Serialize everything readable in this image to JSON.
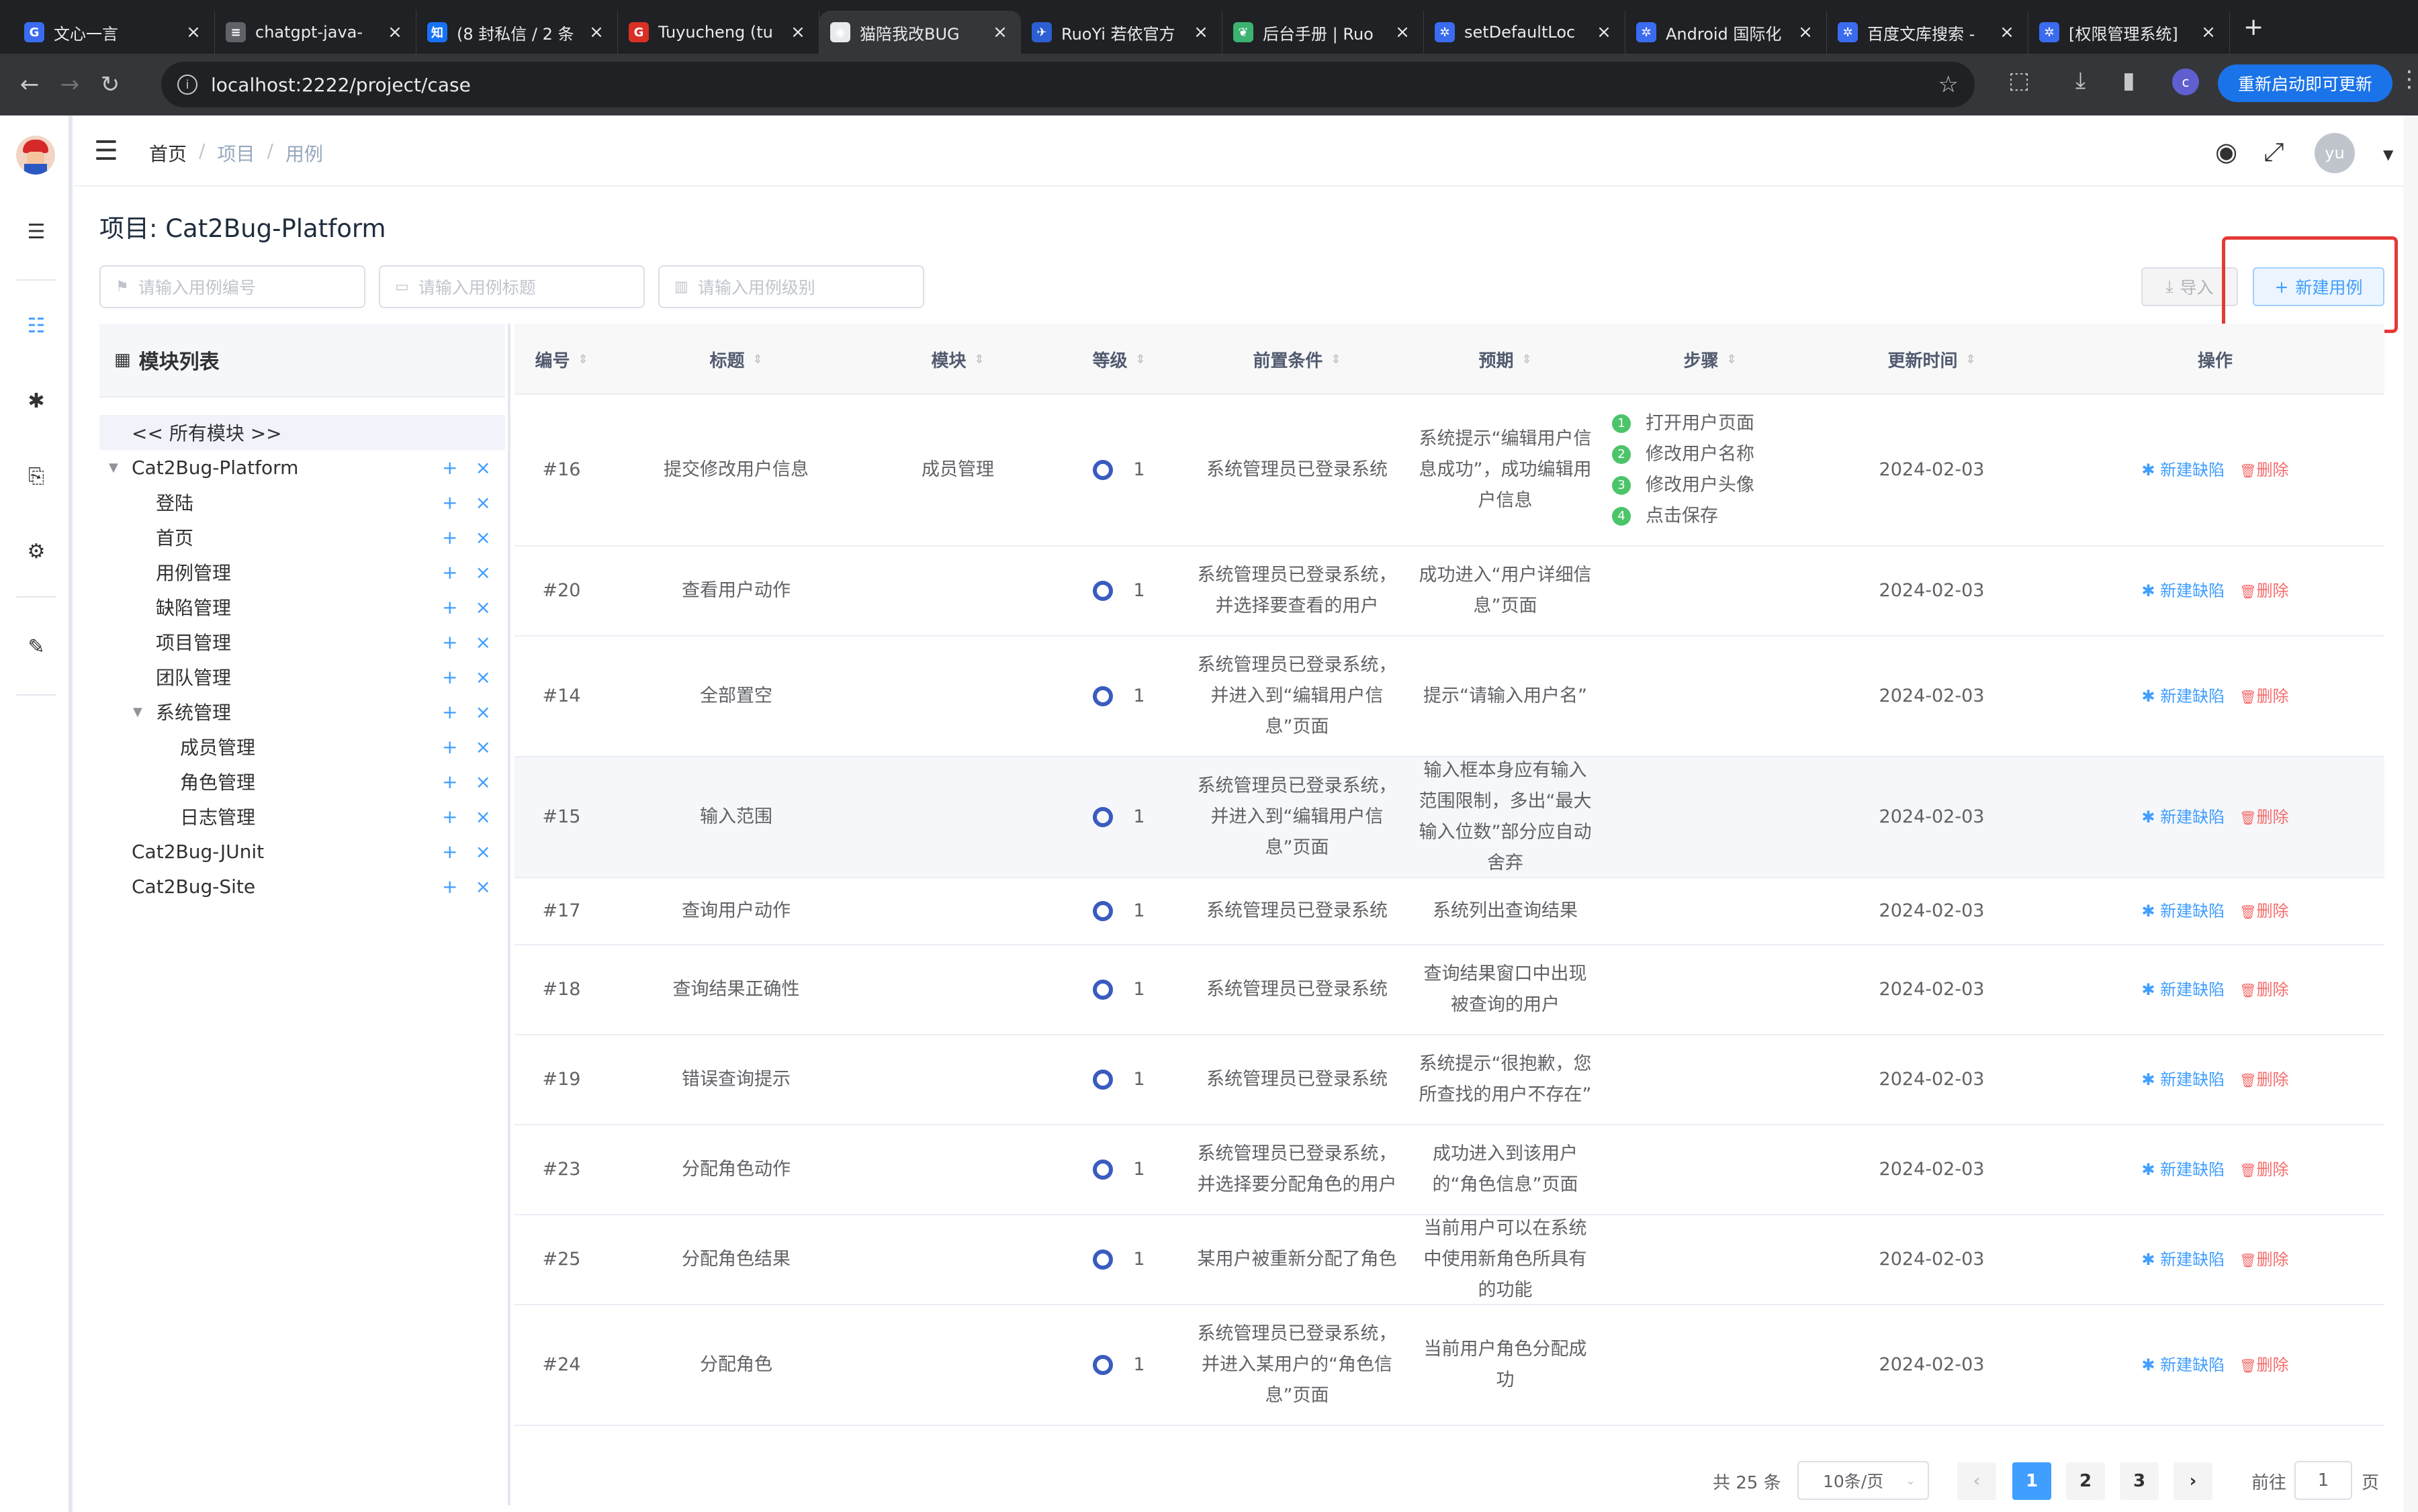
{
  "browser": {
    "tabs": [
      {
        "title": "文心一言",
        "icon_color": "#3b6cf0",
        "icon": "G"
      },
      {
        "title": "chatgpt-java-",
        "icon_color": "#5f6368",
        "icon": "≡"
      },
      {
        "title": "(8 封私信 / 2 条",
        "icon_color": "#1772f6",
        "icon": "知"
      },
      {
        "title": "Tuyucheng (tu",
        "icon_color": "#d93025",
        "icon": "G"
      },
      {
        "title": "猫陪我改BUG",
        "icon_color": "#e8eaed",
        "icon": "◉"
      },
      {
        "title": "RuoYi 若依官方",
        "icon_color": "#2c5fd1",
        "icon": "✈"
      },
      {
        "title": "后台手册 | Ruo",
        "icon_color": "#3cb371",
        "icon": "❦"
      },
      {
        "title": "setDefaultLoc",
        "icon_color": "#3b6cf0",
        "icon": "✲"
      },
      {
        "title": "Android 国际化",
        "icon_color": "#3b6cf0",
        "icon": "✲"
      },
      {
        "title": "百度文库搜索 -",
        "icon_color": "#3b6cf0",
        "icon": "✲"
      },
      {
        "title": "[权限管理系统]",
        "icon_color": "#3b6cf0",
        "icon": "✲"
      }
    ],
    "active_tab": 4,
    "url": "localhost:2222/project/case",
    "update_label": "重新启动即可更新",
    "profile_initial": "c"
  },
  "header": {
    "breadcrumb": [
      "首页",
      "项目",
      "用例"
    ],
    "avatar_text": "yu"
  },
  "page": {
    "title": "项目: Cat2Bug-Platform",
    "filters": {
      "case_number_placeholder": "请输入用例编号",
      "case_title_placeholder": "请输入用例标题",
      "case_level_placeholder": "请输入用例级别"
    },
    "import_label": "导入",
    "new_case_label": "新建用例"
  },
  "modules": {
    "title": "模块列表",
    "all_label": "<< 所有模块 >>",
    "items": [
      {
        "label": "Cat2Bug-Platform",
        "depth": 0,
        "expanded": true
      },
      {
        "label": "登陆",
        "depth": 1
      },
      {
        "label": "首页",
        "depth": 1
      },
      {
        "label": "用例管理",
        "depth": 1
      },
      {
        "label": "缺陷管理",
        "depth": 1
      },
      {
        "label": "项目管理",
        "depth": 1
      },
      {
        "label": "团队管理",
        "depth": 1
      },
      {
        "label": "系统管理",
        "depth": 1,
        "expanded": true
      },
      {
        "label": "成员管理",
        "depth": 2
      },
      {
        "label": "角色管理",
        "depth": 2
      },
      {
        "label": "日志管理",
        "depth": 2
      },
      {
        "label": "Cat2Bug-JUnit",
        "depth": 0
      },
      {
        "label": "Cat2Bug-Site",
        "depth": 0
      }
    ],
    "add_icon": "+",
    "remove_icon": "×"
  },
  "table": {
    "columns": [
      "编号",
      "标题",
      "模块",
      "等级",
      "前置条件",
      "预期",
      "步骤",
      "更新时间",
      "操作"
    ],
    "actions": {
      "new_defect": "新建缺陷",
      "delete": "删除"
    },
    "rows": [
      {
        "id": "#16",
        "title": "提交修改用户信息",
        "module": "成员管理",
        "level": "1",
        "precondition": "系统管理员已登录系统",
        "expected": "系统提示“编辑用户信息成功”，成功编辑用户信息",
        "steps": [
          "打开用户页面",
          "修改用户名称",
          "修改用户头像",
          "点击保存"
        ],
        "updated": "2024-02-03"
      },
      {
        "id": "#20",
        "title": "查看用户动作",
        "module": "",
        "level": "1",
        "precondition": "系统管理员已登录系统，并选择要查看的用户",
        "expected": "成功进入“用户详细信息”页面",
        "steps": [],
        "updated": "2024-02-03"
      },
      {
        "id": "#14",
        "title": "全部置空",
        "module": "",
        "level": "1",
        "precondition": "系统管理员已登录系统，并进入到“编辑用户信息”页面",
        "expected": "提示“请输入用户名”",
        "steps": [],
        "updated": "2024-02-03"
      },
      {
        "id": "#15",
        "title": "输入范围",
        "module": "",
        "level": "1",
        "precondition": "系统管理员已登录系统，并进入到“编辑用户信息”页面",
        "expected": "输入框本身应有输入范围限制，多出“最大输入位数”部分应自动舍弃",
        "steps": [],
        "updated": "2024-02-03"
      },
      {
        "id": "#17",
        "title": "查询用户动作",
        "module": "",
        "level": "1",
        "precondition": "系统管理员已登录系统",
        "expected": "系统列出查询结果",
        "steps": [],
        "updated": "2024-02-03"
      },
      {
        "id": "#18",
        "title": "查询结果正确性",
        "module": "",
        "level": "1",
        "precondition": "系统管理员已登录系统",
        "expected": "查询结果窗口中出现被查询的用户",
        "steps": [],
        "updated": "2024-02-03"
      },
      {
        "id": "#19",
        "title": "错误查询提示",
        "module": "",
        "level": "1",
        "precondition": "系统管理员已登录系统",
        "expected": "系统提示“很抱歉，您所查找的用户不存在”",
        "steps": [],
        "updated": "2024-02-03"
      },
      {
        "id": "#23",
        "title": "分配角色动作",
        "module": "",
        "level": "1",
        "precondition": "系统管理员已登录系统，并选择要分配角色的用户",
        "expected": "成功进入到该用户的“角色信息”页面",
        "steps": [],
        "updated": "2024-02-03"
      },
      {
        "id": "#25",
        "title": "分配角色结果",
        "module": "",
        "level": "1",
        "precondition": "某用户被重新分配了角色",
        "expected": "当前用户可以在系统中使用新角色所具有的功能",
        "steps": [],
        "updated": "2024-02-03"
      },
      {
        "id": "#24",
        "title": "分配角色",
        "module": "",
        "level": "1",
        "precondition": "系统管理员已登录系统，并进入某用户的“角色信息”页面",
        "expected": "当前用户角色分配成功",
        "steps": [],
        "updated": "2024-02-03"
      }
    ]
  },
  "pagination": {
    "total_text": "共 25 条",
    "page_size": "10条/页",
    "pages": [
      "1",
      "2",
      "3"
    ],
    "current_page": "1",
    "goto_label": "前往",
    "goto_value": "1",
    "page_unit": "页"
  },
  "colors": {
    "primary": "#409eff",
    "danger": "#f56c6c",
    "highlight_box": "#e53935",
    "step_badge": "#4cc46a"
  }
}
